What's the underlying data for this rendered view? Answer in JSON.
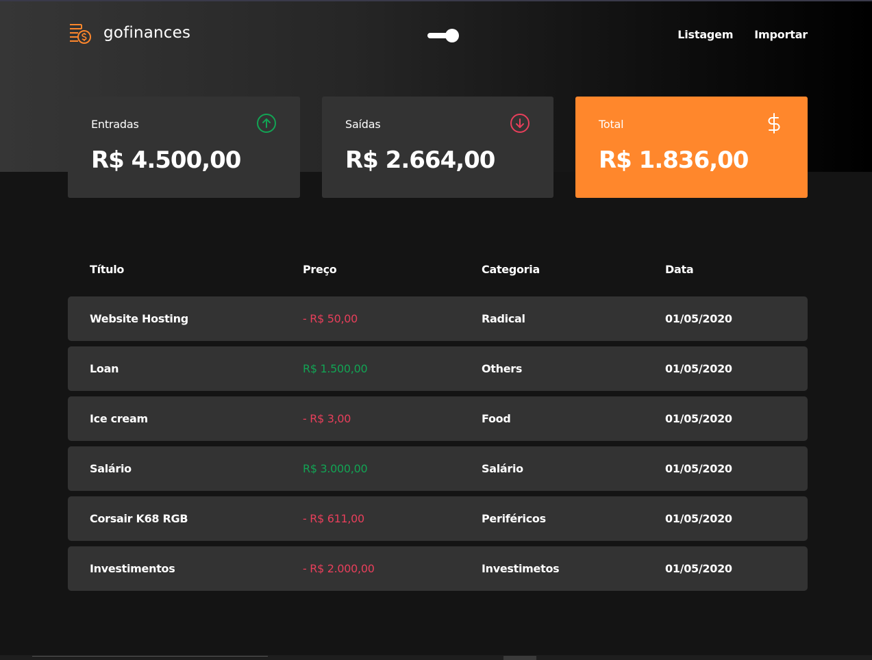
{
  "brand": {
    "name": "gofinances",
    "accent": "#ff872c"
  },
  "theme_toggle": {
    "state": "on"
  },
  "nav": {
    "items": [
      {
        "label": "Listagem"
      },
      {
        "label": "Importar"
      }
    ]
  },
  "cards": {
    "income": {
      "label": "Entradas",
      "value": "R$ 4.500,00",
      "icon": "arrow-up-circle-icon",
      "color": "#12a454"
    },
    "outcome": {
      "label": "Saídas",
      "value": "R$ 2.664,00",
      "icon": "arrow-down-circle-icon",
      "color": "#e83f5b"
    },
    "total": {
      "label": "Total",
      "value": "R$ 1.836,00",
      "icon": "dollar-sign-icon",
      "color": "#ff872c"
    }
  },
  "table": {
    "headers": {
      "title": "Título",
      "price": "Preço",
      "category": "Categoria",
      "date": "Data"
    },
    "rows": [
      {
        "title": "Website Hosting",
        "price": "- R$ 50,00",
        "type": "outcome",
        "category": "Radical",
        "date": "01/05/2020"
      },
      {
        "title": "Loan",
        "price": "R$ 1.500,00",
        "type": "income",
        "category": "Others",
        "date": "01/05/2020"
      },
      {
        "title": "Ice cream",
        "price": "- R$ 3,00",
        "type": "outcome",
        "category": "Food",
        "date": "01/05/2020"
      },
      {
        "title": "Salário",
        "price": "R$ 3.000,00",
        "type": "income",
        "category": "Salário",
        "date": "01/05/2020"
      },
      {
        "title": "Corsair K68 RGB",
        "price": "- R$ 611,00",
        "type": "outcome",
        "category": "Periféricos",
        "date": "01/05/2020"
      },
      {
        "title": "Investimentos",
        "price": "- R$ 2.000,00",
        "type": "outcome",
        "category": "Investimetos",
        "date": "01/05/2020"
      }
    ]
  }
}
